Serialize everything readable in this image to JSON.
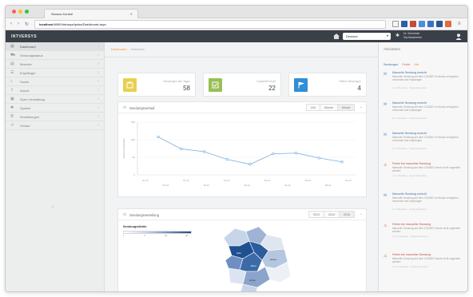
{
  "colors": {
    "accent_orange": "#f0983a",
    "stat_yellow": "#e9d04f",
    "stat_green": "#97c055",
    "stat_blue": "#2f8fd8",
    "chart_line": "#7ab0e0",
    "map_dark": "#1f4f8f",
    "map_light": "#c7d5e8",
    "header_dark": "#3a4048",
    "warn_red": "#e05a4a"
  },
  "browser": {
    "tab_title": "Sensus Kontrol",
    "url_host": "localhost",
    "url_path": ":8080/Intrasys/Ipdsa/Dashboard.aspx",
    "toolbar_icons": [
      "reader-icon",
      "extension-blue-icon",
      "extension-red-icon",
      "cloud-icon",
      "puzzle-icon",
      "pocket-icon",
      "menu-icon"
    ]
  },
  "app": {
    "logo": "INTVERSYS",
    "language": "Deutsch",
    "user_line1": "Hr. Schneider",
    "user_line2": "Sachbearbeiter"
  },
  "sidebar": {
    "items": [
      {
        "label": "Dashboard",
        "icon": "dashboard-icon",
        "active": true
      },
      {
        "label": "Sendungsstatus",
        "icon": "truck-icon"
      },
      {
        "label": "Berichte",
        "icon": "chart-icon"
      },
      {
        "label": "Empfänger",
        "icon": "users-icon"
      },
      {
        "label": "Suche",
        "icon": "search-icon"
      },
      {
        "label": "Import",
        "icon": "upload-icon"
      },
      {
        "label": "Sperr-Verwaltung",
        "icon": "lock-icon"
      },
      {
        "label": "System",
        "icon": "gear-icon"
      },
      {
        "label": "Einstellungen",
        "icon": "list-icon"
      },
      {
        "label": "Verlauf",
        "icon": "history-icon"
      }
    ]
  },
  "breadcrumb": {
    "current": "Dashboard",
    "section": "Übersicht"
  },
  "stats": [
    {
      "label": "Sendungen des Tages",
      "value": "58",
      "icon": "box-icon"
    },
    {
      "label": "Zugestellt heute",
      "value": "22",
      "icon": "check-icon"
    },
    {
      "label": "Offene Meldungen",
      "value": "4",
      "icon": "flag-icon"
    }
  ],
  "line_card": {
    "title": "Sendungsverlauf",
    "ranges": [
      "24h",
      "Woche",
      "Monat"
    ],
    "active_range": "Monat"
  },
  "chart_data": {
    "type": "line",
    "x": [
      "01.12",
      "04.12",
      "07.12",
      "10.12",
      "13.12",
      "16.12",
      "19.12",
      "22.12",
      "25.12",
      "28.12",
      "31.12"
    ],
    "series": [
      {
        "values": [
          108,
          74,
          66,
          44,
          30,
          60,
          62,
          48,
          37
        ]
      }
    ],
    "ylim": [
      0,
      150
    ],
    "yticks": [
      0,
      50,
      100,
      150
    ],
    "ylabel": "Anzahl Sendungen"
  },
  "map_card": {
    "title": "Sendungsverteilung",
    "ranges": [
      "2013",
      "2014",
      "2015"
    ],
    "active_range": "2015",
    "legend_title": "Sendungsdichte",
    "legend_ticks": [
      "1",
      "3",
      "10",
      "30"
    ],
    "region_labels": [
      "Köln",
      "Bonn",
      "Düren",
      "Essen"
    ]
  },
  "activity": {
    "title": "Aktivitäten",
    "tabs": [
      "Sendungen",
      "Fehler",
      "Alle"
    ],
    "items": [
      {
        "type": "info",
        "icon": "envelope-icon",
        "title": "Manuelle Sendung erreicht",
        "desc": "Manuelle Sendung auf dem 1234567 im Modus erfolgreich versendet und empfangen",
        "meta": "vor 2 Stunden · Systembenutzer"
      },
      {
        "type": "info",
        "icon": "envelope-icon",
        "title": "Manuelle Sendung erreicht",
        "desc": "Manuelle Sendung auf dem 1234567 im Modus erfolgreich versendet und empfangen",
        "meta": "vor 4 Stunden · Systembenutzer"
      },
      {
        "type": "info",
        "icon": "envelope-icon",
        "title": "Manuelle Sendung erreicht",
        "desc": "Manuelle Sendung auf dem 1234567 im Modus erfolgreich versendet und empfangen",
        "meta": "vor 6 Stunden · Systembenutzer"
      },
      {
        "type": "warn",
        "icon": "warning-icon",
        "title": "Fehler bei manueller Sendung",
        "desc": "Manuelle Sendung auf dem 1234567 konnte nicht zugestellt werden",
        "meta": "vor 7 Stunden · Systembenutzer"
      },
      {
        "type": "info",
        "icon": "envelope-icon",
        "title": "Manuelle Sendung erreicht",
        "desc": "Manuelle Sendung auf dem 1234567 im Modus erfolgreich versendet und empfangen",
        "meta": "vor 9 Stunden · Systembenutzer"
      },
      {
        "type": "warn",
        "icon": "warning-icon",
        "title": "Fehler bei manueller Sendung",
        "desc": "Manuelle Sendung auf dem 1234567 konnte nicht zugestellt werden",
        "meta": "vor 11 Stunden · Systembenutzer"
      },
      {
        "type": "warn",
        "icon": "warning-icon",
        "title": "Fehler bei manueller Sendung",
        "desc": "Manuelle Sendung auf dem 1234567 konnte nicht zugestellt werden",
        "meta": "vor 14 Stunden · Systembenutzer"
      }
    ]
  }
}
